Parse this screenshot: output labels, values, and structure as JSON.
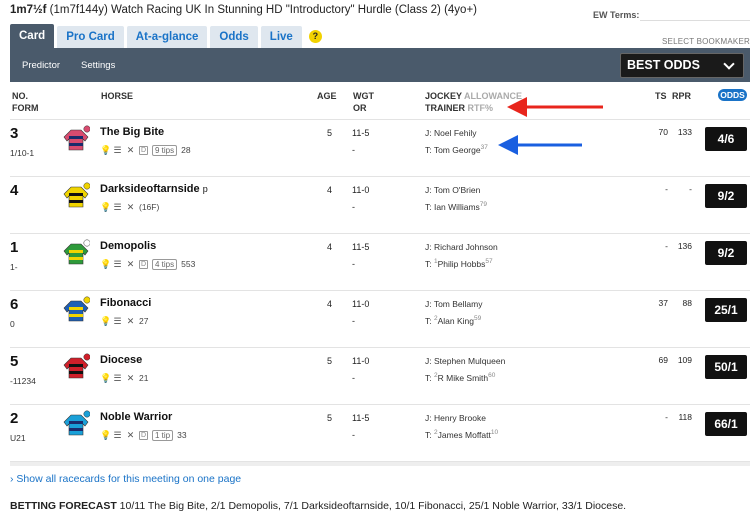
{
  "race": {
    "distance": "1m7½f",
    "distance_detail": "(1m7f144y)",
    "title": "Watch Racing UK In Stunning HD \"Introductory\" Hurdle (Class 2) (4yo+)"
  },
  "ew_label": "EW Terms:",
  "tabs": [
    {
      "label": "Card",
      "active": true
    },
    {
      "label": "Pro Card"
    },
    {
      "label": "At-a-glance"
    },
    {
      "label": "Odds"
    },
    {
      "label": "Live"
    }
  ],
  "help_label": "?",
  "select_bookmaker": "SELECT BOOKMAKER",
  "subnav": {
    "predictor": "Predictor",
    "settings": "Settings",
    "best_odds": "BEST ODDS"
  },
  "headers": {
    "no": "NO.",
    "form": "FORM",
    "horse": "HORSE",
    "age": "AGE",
    "wgt": "WGT",
    "or": "OR",
    "jockey": "JOCKEY",
    "allowance": "ALLOWANCE",
    "trainer": "TRAINER",
    "rtf": "RTF%",
    "ts": "TS",
    "rpr": "RPR",
    "odds": "ODDS"
  },
  "runners": [
    {
      "no": "3",
      "form": "1/10-1",
      "name": "The Big Bite",
      "suffix": "",
      "days": "28",
      "tips": "9 tips",
      "age": "5",
      "wgt": "11-5",
      "or": "-",
      "jockey": "J: Noel Fehily",
      "trainer": "T: Tom George",
      "trainer_rtf": "37",
      "trainer_prefix": "",
      "ts": "70",
      "rpr": "133",
      "odds": "4/6",
      "silk": {
        "body": "#d94b6f",
        "stripe": "#1b2b6b",
        "cap": "#d94b6f"
      }
    },
    {
      "no": "4",
      "form": "",
      "name": "Darksideoftarnside",
      "suffix": "p",
      "days": "(16F)",
      "tips": "",
      "age": "4",
      "wgt": "11-0",
      "or": "-",
      "jockey": "J: Tom O'Brien",
      "trainer": "T: Ian Williams",
      "trainer_rtf": "79",
      "trainer_prefix": "",
      "ts": "-",
      "rpr": "-",
      "odds": "9/2",
      "silk": {
        "body": "#f0d400",
        "stripe": "#111111",
        "cap": "#f0d400"
      }
    },
    {
      "no": "1",
      "form": "1-",
      "name": "Demopolis",
      "suffix": "",
      "days": "553",
      "tips": "4 tips",
      "age": "4",
      "wgt": "11-5",
      "or": "-",
      "jockey": "J: Richard Johnson",
      "trainer": "Philip Hobbs",
      "trainer_rtf": "57",
      "trainer_prefix": "1",
      "ts": "-",
      "rpr": "136",
      "odds": "9/2",
      "silk": {
        "body": "#2e9a3a",
        "stripe": "#f0d400",
        "cap": "#ffffff"
      }
    },
    {
      "no": "6",
      "form": "0",
      "name": "Fibonacci",
      "suffix": "",
      "days": "27",
      "tips": "",
      "age": "4",
      "wgt": "11-0",
      "or": "-",
      "jockey": "J: Tom Bellamy",
      "trainer": "Alan King",
      "trainer_rtf": "59",
      "trainer_prefix": "2",
      "ts": "37",
      "rpr": "88",
      "odds": "25/1",
      "silk": {
        "body": "#1d5fb5",
        "stripe": "#f0d400",
        "cap": "#f0d400"
      }
    },
    {
      "no": "5",
      "form": "-11234",
      "name": "Diocese",
      "suffix": "",
      "days": "21",
      "tips": "",
      "age": "5",
      "wgt": "11-0",
      "or": "-",
      "jockey": "J: Stephen Mulqueen",
      "trainer": "R Mike Smith",
      "trainer_rtf": "60",
      "trainer_prefix": "2",
      "ts": "69",
      "rpr": "109",
      "odds": "50/1",
      "silk": {
        "body": "#d01f2a",
        "stripe": "#111111",
        "cap": "#d01f2a"
      }
    },
    {
      "no": "2",
      "form": "U21",
      "name": "Noble Warrior",
      "suffix": "",
      "days": "33",
      "tips": "1 tip",
      "age": "5",
      "wgt": "11-5",
      "or": "-",
      "jockey": "J: Henry Brooke",
      "trainer": "James Moffatt",
      "trainer_rtf": "10",
      "trainer_prefix": "2",
      "ts": "-",
      "rpr": "118",
      "odds": "66/1",
      "silk": {
        "body": "#1aa0d8",
        "stripe": "#1b2b6b",
        "cap": "#1aa0d8"
      }
    }
  ],
  "show_all": "Show all racecards for this meeting on one page",
  "forecast": {
    "label": "BETTING FORECAST",
    "text": "10/11 The Big Bite, 2/1 Demopolis, 7/1 Darksideoftarnside, 10/1 Fibonacci, 25/1 Noble Warrior, 33/1 Diocese."
  },
  "annotations": {
    "red_arrow_color": "#e8251c",
    "blue_arrow_color": "#1a5fe0"
  }
}
